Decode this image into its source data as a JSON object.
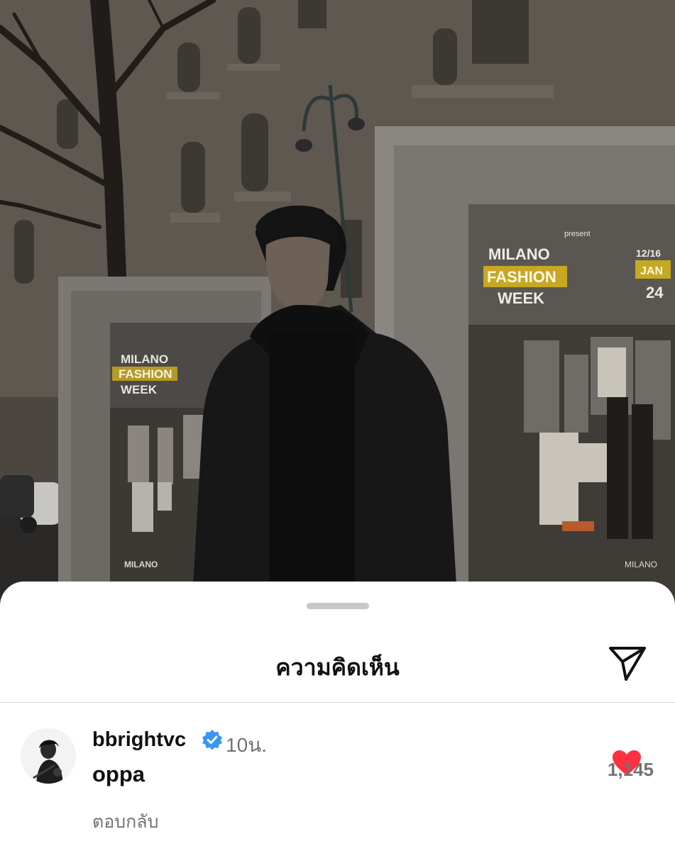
{
  "photo": {
    "description_icon": "photo-backdrop",
    "poster_left": {
      "line1": "MILANO",
      "line2": "FASHION",
      "line3": "WEEK",
      "footer": "MILANO"
    },
    "poster_right": {
      "line1": "MILANO",
      "line2": "FASHION",
      "line3": "WEEK",
      "date1": "12/16",
      "date2": "JAN",
      "date3": "24",
      "present": "present",
      "footer": "MILANO"
    }
  },
  "sheet": {
    "title": "ความคิดเห็น",
    "share_icon": "paper-plane-icon"
  },
  "comment": {
    "username": "bbrightvc",
    "verified_icon": "verified-badge-icon",
    "time": "10น.",
    "text": "oppa",
    "reply_label": "ตอบกลับ",
    "like_icon": "heart-icon",
    "like_count": "1,145"
  },
  "colors": {
    "heart": "#ff3040",
    "verified": "#3897f0",
    "secondary_text": "#737373"
  }
}
